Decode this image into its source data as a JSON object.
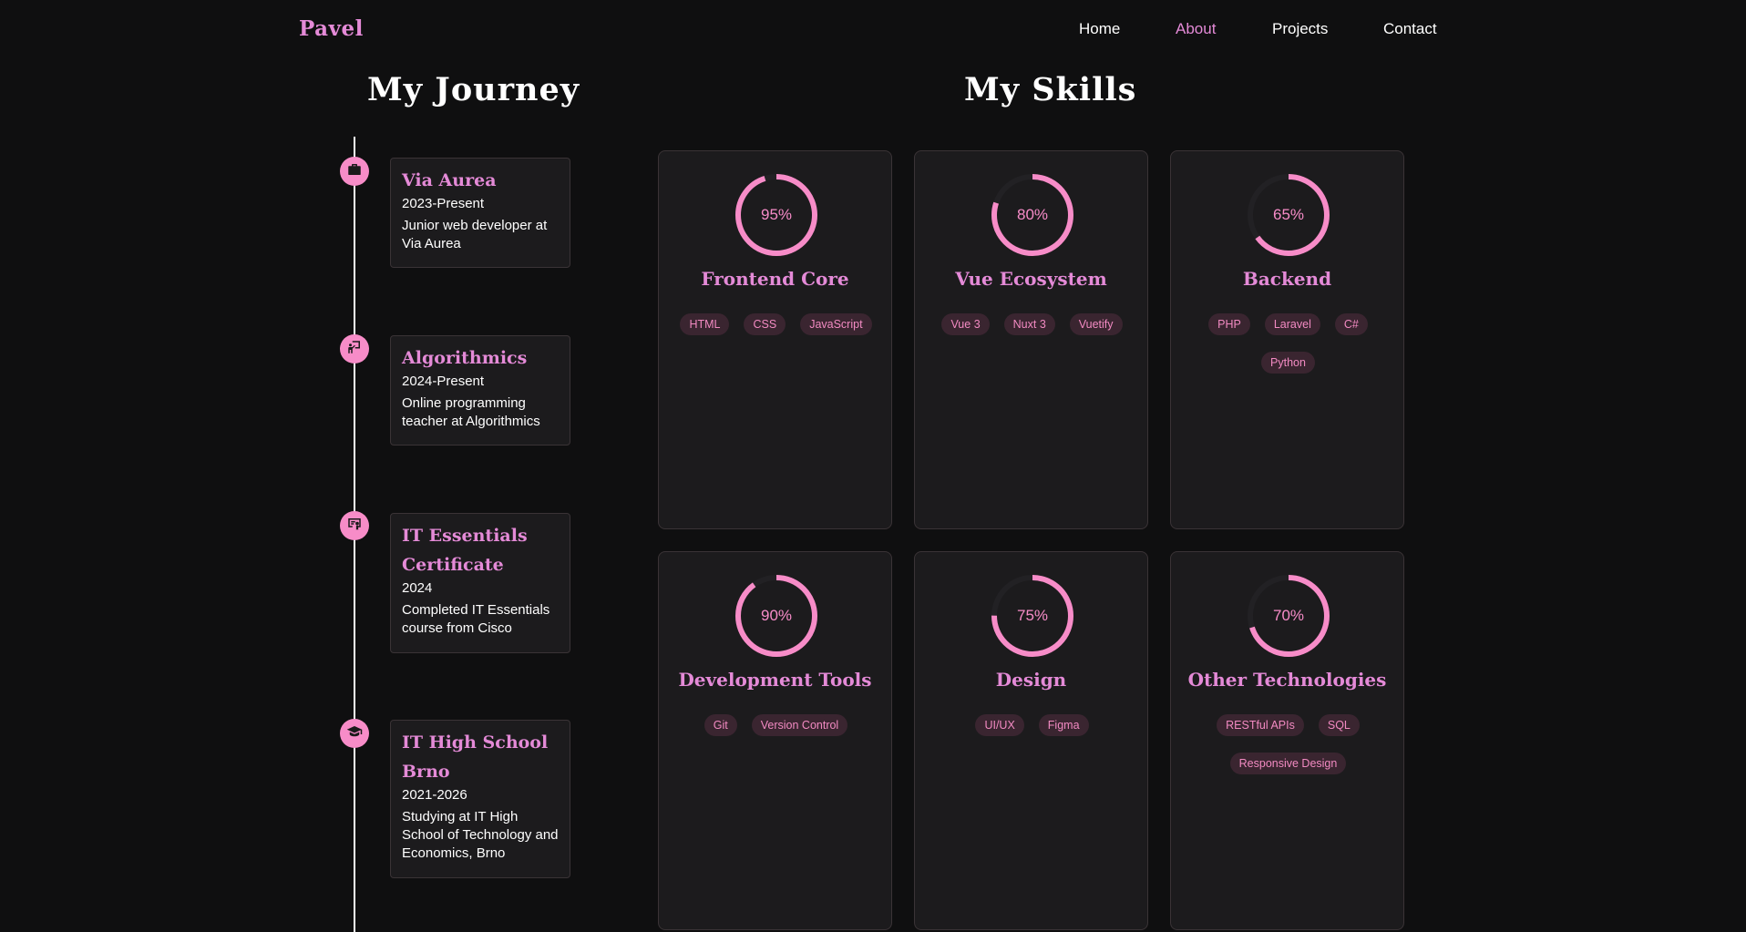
{
  "colors": {
    "accent": "#f78cc8",
    "accent_text": "#e48ad7",
    "tag_bg": "#3a2530",
    "tag_text": "#f28ac2",
    "ring_track": "#222124"
  },
  "nav": {
    "logo": "Pavel",
    "links": [
      {
        "label": "Home",
        "active": false
      },
      {
        "label": "About",
        "active": true
      },
      {
        "label": "Projects",
        "active": false
      },
      {
        "label": "Contact",
        "active": false
      }
    ]
  },
  "journey": {
    "title": "My Journey",
    "items": [
      {
        "icon": "briefcase-icon",
        "title": "Via Aurea",
        "date": "2023-Present",
        "description": "Junior web developer at Via Aurea"
      },
      {
        "icon": "teacher-icon",
        "title": "Algorithmics",
        "date": "2024-Present",
        "description": "Online programming teacher at Algorithmics"
      },
      {
        "icon": "certificate-icon",
        "title": "IT Essentials Certificate",
        "date": "2024",
        "description": "Completed IT Essentials course from Cisco"
      },
      {
        "icon": "graduation-cap-icon",
        "title": "IT High School Brno",
        "date": "2021-2026",
        "description": "Studying at IT High School of Technology and Economics, Brno"
      }
    ]
  },
  "skills": {
    "title": "My Skills",
    "cards": [
      {
        "name": "Frontend Core",
        "percent": 95,
        "percent_label": "95%",
        "tags": [
          "HTML",
          "CSS",
          "JavaScript"
        ]
      },
      {
        "name": "Vue Ecosystem",
        "percent": 80,
        "percent_label": "80%",
        "tags": [
          "Vue 3",
          "Nuxt 3",
          "Vuetify"
        ]
      },
      {
        "name": "Backend",
        "percent": 65,
        "percent_label": "65%",
        "tags": [
          "PHP",
          "Laravel",
          "C#",
          "Python"
        ]
      },
      {
        "name": "Development Tools",
        "percent": 90,
        "percent_label": "90%",
        "tags": [
          "Git",
          "Version Control"
        ]
      },
      {
        "name": "Design",
        "percent": 75,
        "percent_label": "75%",
        "tags": [
          "UI/UX",
          "Figma"
        ]
      },
      {
        "name": "Other Technologies",
        "percent": 70,
        "percent_label": "70%",
        "tags": [
          "RESTful APIs",
          "SQL",
          "Responsive Design"
        ]
      }
    ]
  }
}
